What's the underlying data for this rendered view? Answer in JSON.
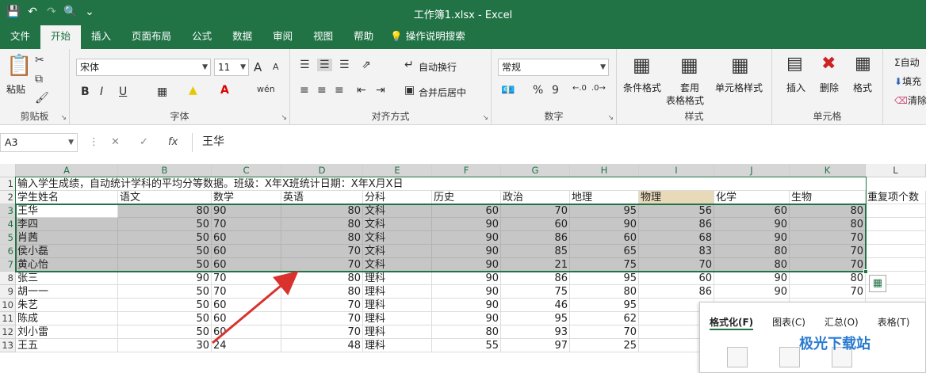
{
  "window": {
    "title": "工作簿1.xlsx  -  Excel"
  },
  "qat": {
    "customize_glyph": "⌄"
  },
  "tabs": [
    "文件",
    "开始",
    "插入",
    "页面布局",
    "公式",
    "数据",
    "审阅",
    "视图",
    "帮助"
  ],
  "active_tab": "开始",
  "tell_me": "操作说明搜索",
  "ribbon": {
    "clipboard": {
      "paste": "粘贴",
      "label": "剪贴板"
    },
    "font": {
      "name": "宋体",
      "size": "11",
      "label": "字体",
      "bold": "B",
      "italic": "I",
      "underline": "U",
      "grow": "A",
      "shrink": "A",
      "wen": "wén",
      "color_a": "A"
    },
    "alignment": {
      "wrap": "自动换行",
      "merge": "合并后居中",
      "label": "对齐方式"
    },
    "number": {
      "format": "常规",
      "pct": "%",
      "comma": "9",
      "label": "数字"
    },
    "styles": {
      "conditional": "条件格式",
      "table_top": "套用",
      "table_bottom": "表格格式",
      "cell_styles": "单元格样式",
      "label": "样式"
    },
    "cells": {
      "insert": "插入",
      "delete": "删除",
      "format": "格式",
      "label": "单元格"
    },
    "editing": {
      "autosum": "自动",
      "fill": "填充",
      "clear": "清除"
    }
  },
  "formula_bar": {
    "name_box": "A3",
    "fx": "fx",
    "content": "王华"
  },
  "columns": [
    "A",
    "B",
    "C",
    "D",
    "E",
    "F",
    "G",
    "H",
    "I",
    "J",
    "K",
    "L"
  ],
  "row1": "输入学生成绩，自动统计学科的平均分等数据。班级：X年X班统计日期：X年X月X日",
  "headers": [
    "学生姓名",
    "语文",
    "数学",
    "英语",
    "分科",
    "历史",
    "政治",
    "地理",
    "物理",
    "化学",
    "生物",
    "重复项个数"
  ],
  "rows": [
    [
      "王华",
      "80",
      "90",
      "80",
      "文科",
      "60",
      "70",
      "95",
      "56",
      "60",
      "80"
    ],
    [
      "李四",
      "50",
      "70",
      "80",
      "文科",
      "90",
      "60",
      "90",
      "86",
      "90",
      "80"
    ],
    [
      "肖茜",
      "50",
      "60",
      "80",
      "文科",
      "90",
      "86",
      "60",
      "68",
      "90",
      "70"
    ],
    [
      "侯小磊",
      "50",
      "60",
      "70",
      "文科",
      "90",
      "85",
      "65",
      "83",
      "80",
      "70"
    ],
    [
      "黄心怡",
      "50",
      "60",
      "70",
      "文科",
      "90",
      "21",
      "75",
      "70",
      "80",
      "70"
    ],
    [
      "张三",
      "90",
      "70",
      "80",
      "理科",
      "90",
      "86",
      "95",
      "60",
      "90",
      "80"
    ],
    [
      "胡一一",
      "50",
      "70",
      "80",
      "理科",
      "90",
      "75",
      "80",
      "86",
      "90",
      "70"
    ],
    [
      "朱艺",
      "50",
      "60",
      "70",
      "理科",
      "90",
      "46",
      "95",
      "",
      "",
      ""
    ],
    [
      "陈成",
      "50",
      "60",
      "70",
      "理科",
      "90",
      "95",
      "62",
      "",
      "",
      ""
    ],
    [
      "刘小雷",
      "50",
      "60",
      "70",
      "理科",
      "80",
      "93",
      "70",
      "",
      "",
      ""
    ],
    [
      "王五",
      "30",
      "24",
      "48",
      "理科",
      "55",
      "97",
      "25",
      "",
      "",
      ""
    ]
  ],
  "quick_analysis": {
    "tabs": [
      "格式化(F)",
      "图表(C)",
      "汇总(O)",
      "表格(T)"
    ],
    "active": "格式化(F)"
  },
  "watermark": "极光下载站",
  "colors": {
    "brand": "#217346",
    "selection": "#c6c6c6",
    "arrow": "#d9322e"
  }
}
